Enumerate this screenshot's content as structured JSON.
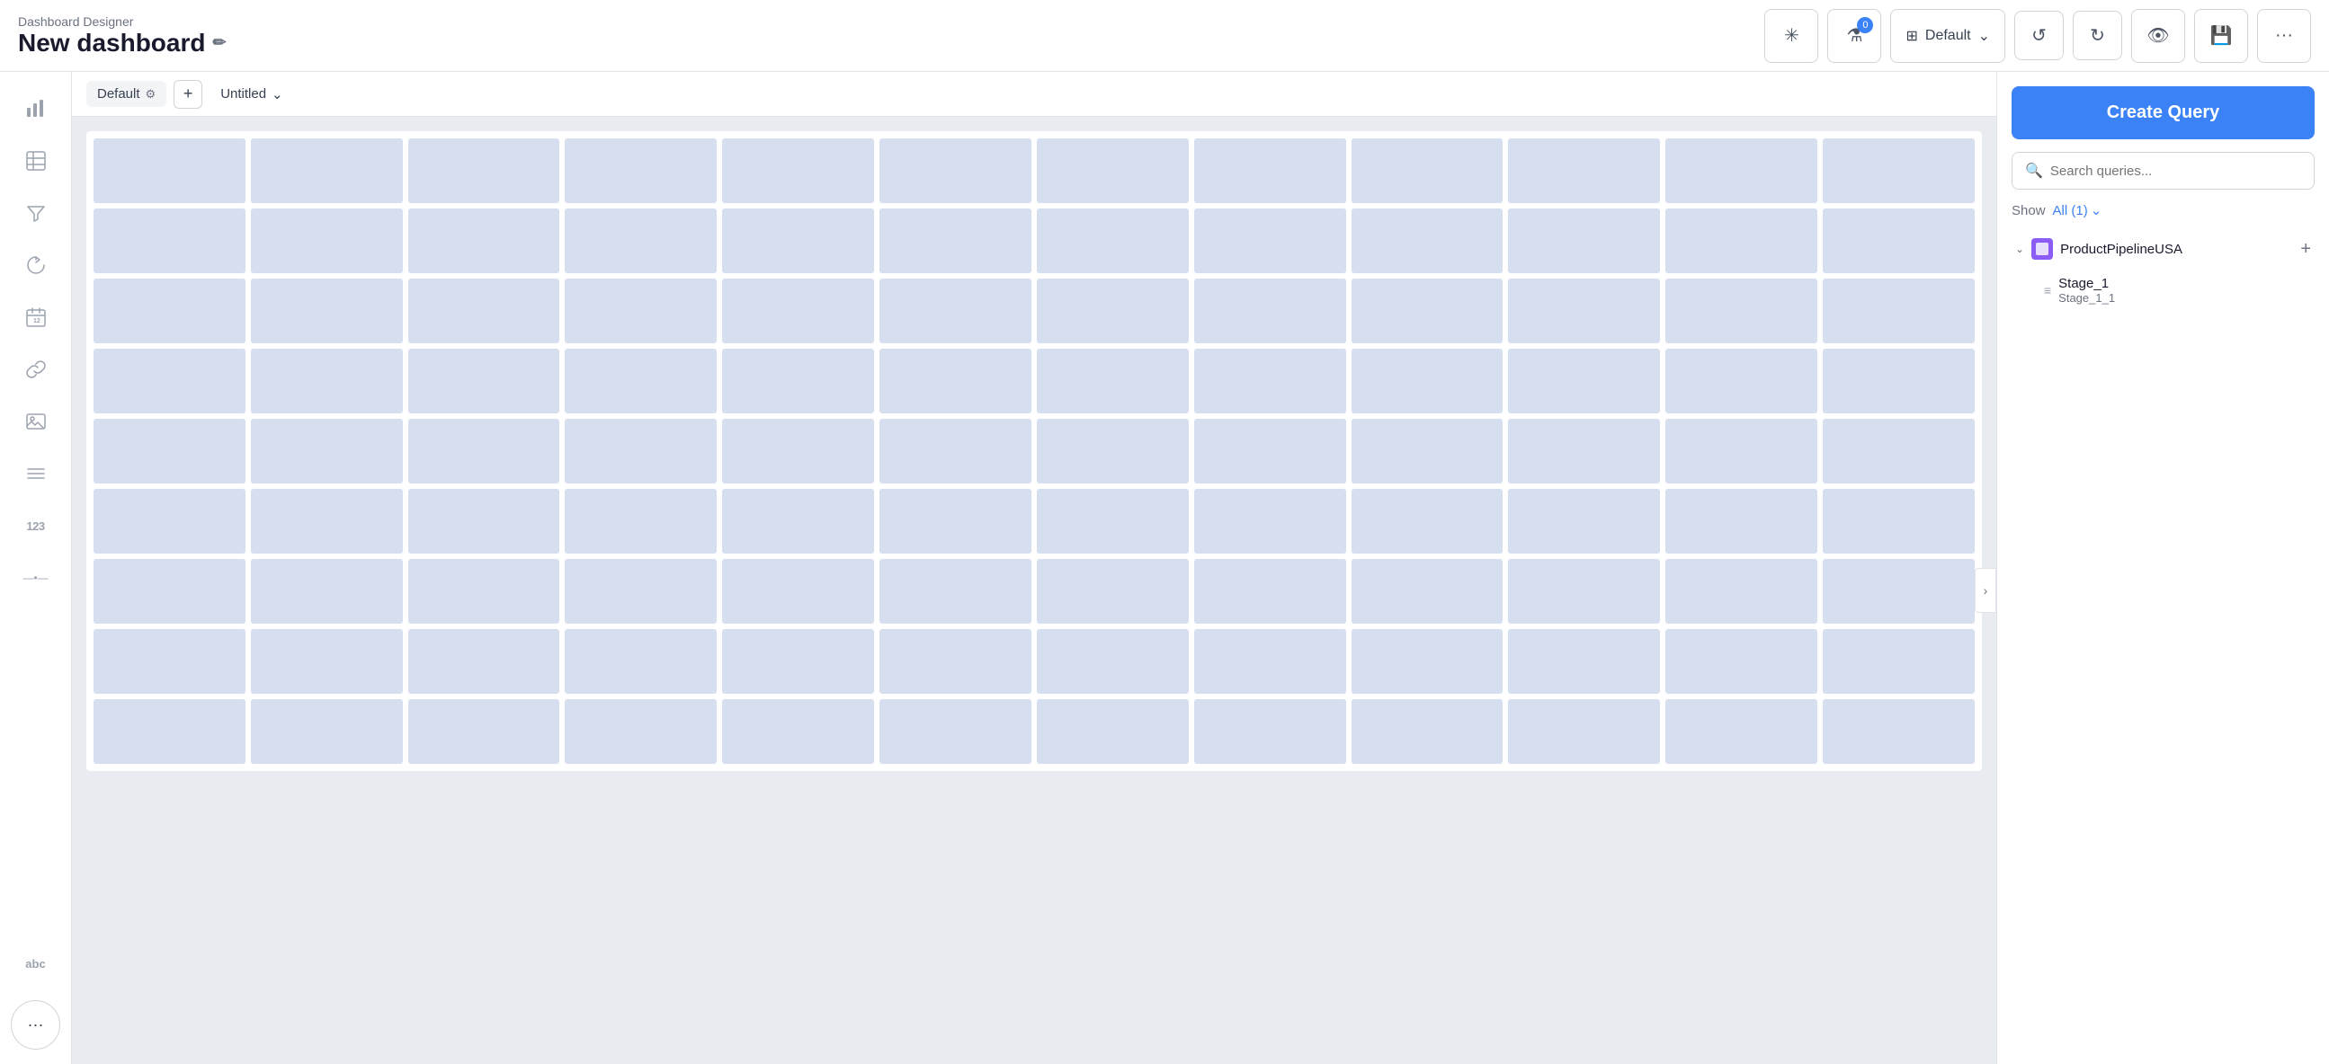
{
  "app": {
    "name": "Dashboard Designer",
    "dashboard_title": "New dashboard",
    "edit_icon": "✏"
  },
  "header": {
    "actions": {
      "spark_label": "✳",
      "filter_label": "⚗",
      "filter_count": "0",
      "layout_label": "Default",
      "undo_label": "↺",
      "redo_label": "↻",
      "preview_label": "👁",
      "save_label": "💾",
      "more_label": "···"
    }
  },
  "tabs": {
    "default_label": "Default",
    "gear_label": "⚙",
    "add_label": "+",
    "untitled_label": "Untitled",
    "dropdown_label": "⌄"
  },
  "right_panel": {
    "create_query_label": "Create Query",
    "search_placeholder": "Search queries...",
    "show_label": "Show",
    "show_all_label": "All (1)",
    "query_group_name": "ProductPipelineUSA",
    "query_item_name": "Stage_1",
    "query_item_sub": "Stage_1_1"
  },
  "sidebar": {
    "icons": [
      {
        "name": "bar-chart-icon",
        "symbol": "📊",
        "label": "Charts"
      },
      {
        "name": "table-icon",
        "symbol": "⊞",
        "label": "Table"
      },
      {
        "name": "filter-icon",
        "symbol": "⚗",
        "label": "Filter"
      },
      {
        "name": "refresh-icon",
        "symbol": "⟳",
        "label": "Refresh"
      },
      {
        "name": "calendar-icon",
        "symbol": "📅",
        "label": "Calendar"
      },
      {
        "name": "link-icon",
        "symbol": "🔗",
        "label": "Link"
      },
      {
        "name": "image-icon",
        "symbol": "🖼",
        "label": "Image"
      },
      {
        "name": "list-icon",
        "symbol": "≡",
        "label": "List"
      },
      {
        "name": "number-icon",
        "symbol": "123",
        "label": "Number"
      },
      {
        "name": "divider-icon",
        "symbol": "—•—",
        "label": "Divider"
      },
      {
        "name": "text-icon",
        "symbol": "abc",
        "label": "Text"
      }
    ]
  }
}
